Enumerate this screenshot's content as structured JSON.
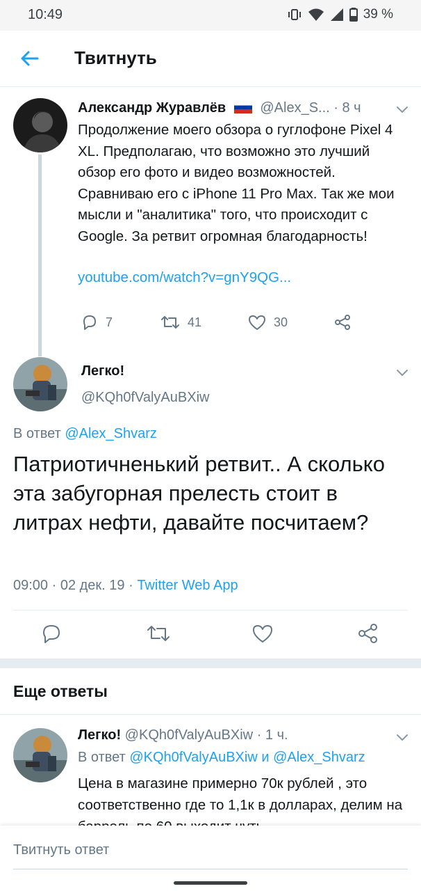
{
  "status_bar": {
    "time": "10:49",
    "battery": "39 %"
  },
  "header": {
    "title": "Твитнуть"
  },
  "parent_tweet": {
    "name": "Александр Журавлёв",
    "handle": "@Alex_S...",
    "time": "· 8 ч",
    "text": "Продолжение моего обзора о гуглофоне Pixel 4 XL. Предполагаю, что возможно это лучший обзор его фото и видео возможностей. Сравниваю его с iPhone 11 Pro Max. Так же мои мысли и \"аналитика\" того, что происходит с Google. За ретвит огромная благодарность!",
    "link": "youtube.com/watch?v=gnY9QG...",
    "replies": "7",
    "retweets": "41",
    "likes": "30"
  },
  "focused_tweet": {
    "name": "Легко!",
    "handle": "@KQh0fValyAuBXiw",
    "reply_prefix": "В ответ",
    "reply_to": "@Alex_Shvarz",
    "text": "Патриотичненький ретвит.. А сколько эта забугорная прелесть стоит в литрах нефти, давайте посчитаем?",
    "timestamp": "09:00 · 02 дек. 19 ·",
    "client": "Twitter Web App"
  },
  "more_replies": {
    "title": "Еще ответы",
    "reply": {
      "name": "Легко!",
      "handle": "@KQh0fValyAuBXiw",
      "time": "· 1 ч.",
      "reply_prefix": "В ответ",
      "reply_to_1": "@KQh0fValyAuBXiw",
      "and": "и",
      "reply_to_2": "@Alex_Shvarz",
      "text": "Цена в магазине примерно 70к рублей , это соответственно где то 1,1к в долларах, делим на баррель по 60 выходит чуть"
    }
  },
  "compose": {
    "placeholder": "Твитнуть ответ"
  },
  "colors": {
    "accent": "#1da1f2",
    "muted": "#657786",
    "divider": "#e6ecf0",
    "flag_white": "#ffffff",
    "flag_blue": "#0039a6",
    "flag_red": "#d52b1e"
  }
}
